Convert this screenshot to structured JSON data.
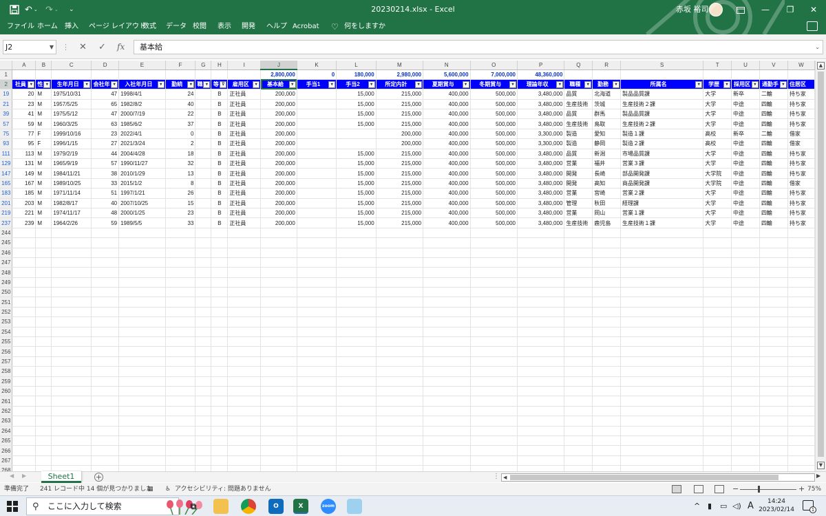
{
  "window": {
    "title": "20230214.xlsx  -  Excel",
    "user_name": "赤坂 裕司",
    "brand_color": "#217346"
  },
  "menu": {
    "tabs": [
      "ファイル",
      "ホーム",
      "挿入",
      "ページ レイアウト",
      "数式",
      "データ",
      "校閲",
      "表示",
      "開発",
      "ヘルプ",
      "Acrobat"
    ],
    "tell_me": "何をしますか"
  },
  "formula_bar": {
    "name_box": "J2",
    "fx": "fx",
    "content": "基本給"
  },
  "grid": {
    "columns": [
      "A",
      "B",
      "C",
      "D",
      "E",
      "F",
      "G",
      "H",
      "I",
      "J",
      "K",
      "L",
      "M",
      "N",
      "O",
      "P",
      "Q",
      "R",
      "S",
      "T",
      "U",
      "V",
      "W"
    ],
    "selected_column": "J",
    "totals_row_number": "1",
    "totals": [
      "",
      "",
      "",
      "",
      "",
      "",
      "",
      "",
      "",
      "2,800,000",
      "0",
      "180,000",
      "2,980,000",
      "5,600,000",
      "7,000,000",
      "48,360,000",
      "",
      "",
      "",
      "",
      "",
      "",
      ""
    ],
    "header_row_number": "2",
    "headers": [
      "社員",
      "性",
      "生年月日",
      "会社年",
      "入社年月日",
      "勤続",
      "職",
      "等",
      "雇用区",
      "基本給",
      "手当1",
      "手当2",
      "所定内計",
      "夏期賞与",
      "冬期賞与",
      "理論年収",
      "職種",
      "勤務",
      "所属名",
      "学歴",
      "採用区",
      "通勤手",
      "住居区"
    ],
    "header_filter_icons": [
      "▾",
      "▾",
      "▾",
      "▾",
      "▾",
      "▾",
      "▾",
      "⊽",
      "▾",
      "▾",
      "▾",
      "▾",
      "▾",
      "▾",
      "▾",
      "▾",
      "▾",
      "▾",
      "▾",
      "▾",
      "▾",
      "▾",
      ""
    ],
    "rows": [
      {
        "n": "19",
        "c": [
          "20",
          "M",
          "1975/10/31",
          "47",
          "1998/4/1",
          "24",
          "",
          "B",
          "正社員",
          "200,000",
          "",
          "15,000",
          "215,000",
          "400,000",
          "500,000",
          "3,480,000",
          "品質",
          "北海道",
          "製品品質課",
          "大学",
          "新卒",
          "二輪",
          "持ち家"
        ]
      },
      {
        "n": "21",
        "c": [
          "23",
          "M",
          "1957/5/25",
          "65",
          "1982/8/2",
          "40",
          "",
          "B",
          "正社員",
          "200,000",
          "",
          "15,000",
          "215,000",
          "400,000",
          "500,000",
          "3,480,000",
          "生産技術",
          "茨城",
          "生産技術２課",
          "大学",
          "中途",
          "四輪",
          "持ち家"
        ]
      },
      {
        "n": "39",
        "c": [
          "41",
          "M",
          "1975/5/12",
          "47",
          "2000/7/19",
          "22",
          "",
          "B",
          "正社員",
          "200,000",
          "",
          "15,000",
          "215,000",
          "400,000",
          "500,000",
          "3,480,000",
          "品質",
          "群馬",
          "製品品質課",
          "大学",
          "中途",
          "四輪",
          "持ち家"
        ]
      },
      {
        "n": "57",
        "c": [
          "59",
          "M",
          "1960/3/25",
          "63",
          "1985/6/2",
          "37",
          "",
          "B",
          "正社員",
          "200,000",
          "",
          "15,000",
          "215,000",
          "400,000",
          "500,000",
          "3,480,000",
          "生産技術",
          "鳥取",
          "生産技術２課",
          "大学",
          "中途",
          "四輪",
          "持ち家"
        ]
      },
      {
        "n": "75",
        "c": [
          "77",
          "F",
          "1999/10/16",
          "23",
          "2022/4/1",
          "0",
          "",
          "B",
          "正社員",
          "200,000",
          "",
          "",
          "200,000",
          "400,000",
          "500,000",
          "3,300,000",
          "製造",
          "愛知",
          "製造１課",
          "高校",
          "新卒",
          "二輪",
          "借家"
        ]
      },
      {
        "n": "93",
        "c": [
          "95",
          "F",
          "1996/1/15",
          "27",
          "2021/3/24",
          "2",
          "",
          "B",
          "正社員",
          "200,000",
          "",
          "",
          "200,000",
          "400,000",
          "500,000",
          "3,300,000",
          "製造",
          "静岡",
          "製造２課",
          "高校",
          "中途",
          "四輪",
          "借家"
        ]
      },
      {
        "n": "111",
        "c": [
          "113",
          "M",
          "1979/2/19",
          "44",
          "2004/4/28",
          "18",
          "",
          "B",
          "正社員",
          "200,000",
          "",
          "15,000",
          "215,000",
          "400,000",
          "500,000",
          "3,480,000",
          "品質",
          "新潟",
          "市場品質課",
          "大学",
          "中途",
          "四輪",
          "持ち家"
        ]
      },
      {
        "n": "129",
        "c": [
          "131",
          "M",
          "1965/9/19",
          "57",
          "1990/11/27",
          "32",
          "",
          "B",
          "正社員",
          "200,000",
          "",
          "15,000",
          "215,000",
          "400,000",
          "500,000",
          "3,480,000",
          "営業",
          "福井",
          "営業３課",
          "大学",
          "中途",
          "四輪",
          "持ち家"
        ]
      },
      {
        "n": "147",
        "c": [
          "149",
          "M",
          "1984/11/21",
          "38",
          "2010/1/29",
          "13",
          "",
          "B",
          "正社員",
          "200,000",
          "",
          "15,000",
          "215,000",
          "400,000",
          "500,000",
          "3,480,000",
          "開発",
          "長崎",
          "部品開発課",
          "大学院",
          "中途",
          "四輪",
          "持ち家"
        ]
      },
      {
        "n": "165",
        "c": [
          "167",
          "M",
          "1989/10/25",
          "33",
          "2015/1/2",
          "8",
          "",
          "B",
          "正社員",
          "200,000",
          "",
          "15,000",
          "215,000",
          "400,000",
          "500,000",
          "3,480,000",
          "開発",
          "高知",
          "商品開発課",
          "大学院",
          "中途",
          "四輪",
          "借家"
        ]
      },
      {
        "n": "183",
        "c": [
          "185",
          "M",
          "1971/11/14",
          "51",
          "1997/1/21",
          "26",
          "",
          "B",
          "正社員",
          "200,000",
          "",
          "15,000",
          "215,000",
          "400,000",
          "500,000",
          "3,480,000",
          "営業",
          "宮崎",
          "営業２課",
          "大学",
          "中途",
          "四輪",
          "持ち家"
        ]
      },
      {
        "n": "201",
        "c": [
          "203",
          "M",
          "1982/8/17",
          "40",
          "2007/10/25",
          "15",
          "",
          "B",
          "正社員",
          "200,000",
          "",
          "15,000",
          "215,000",
          "400,000",
          "500,000",
          "3,480,000",
          "管理",
          "秋田",
          "経理課",
          "大学",
          "中途",
          "四輪",
          "持ち家"
        ]
      },
      {
        "n": "219",
        "c": [
          "221",
          "M",
          "1974/11/17",
          "48",
          "2000/1/25",
          "23",
          "",
          "B",
          "正社員",
          "200,000",
          "",
          "15,000",
          "215,000",
          "400,000",
          "500,000",
          "3,480,000",
          "営業",
          "岡山",
          "営業１課",
          "大学",
          "中途",
          "四輪",
          "持ち家"
        ]
      },
      {
        "n": "237",
        "c": [
          "239",
          "M",
          "1964/2/26",
          "59",
          "1989/5/5",
          "33",
          "",
          "B",
          "正社員",
          "200,000",
          "",
          "15,000",
          "215,000",
          "400,000",
          "500,000",
          "3,480,000",
          "生産技術",
          "鹿児島",
          "生産技術１課",
          "大学",
          "中途",
          "四輪",
          "持ち家"
        ]
      }
    ],
    "empty_row_numbers": [
      "244",
      "245",
      "246",
      "247",
      "248",
      "249",
      "250",
      "251",
      "252",
      "253",
      "254",
      "255",
      "256",
      "257",
      "258",
      "259",
      "260",
      "261",
      "262",
      "263",
      "264",
      "265",
      "266",
      "267",
      "268"
    ]
  },
  "sheets": {
    "active": "Sheet1",
    "add_symbol": "+"
  },
  "status": {
    "ready": "準備完了",
    "filter_result": "241 レコード中 14 個が見つかりました",
    "accessibility": "アクセシビリティ: 問題ありません",
    "zoom_minus": "−",
    "zoom_plus": "+",
    "zoom": "75%"
  },
  "taskbar": {
    "search_placeholder": "ここに入力して検索",
    "time": "14:24",
    "date": "2023/02/14",
    "notifications": "1",
    "ime": "A",
    "apps": [
      "task-view",
      "file-explorer",
      "chrome",
      "outlook",
      "excel",
      "zoom",
      "paint"
    ]
  }
}
